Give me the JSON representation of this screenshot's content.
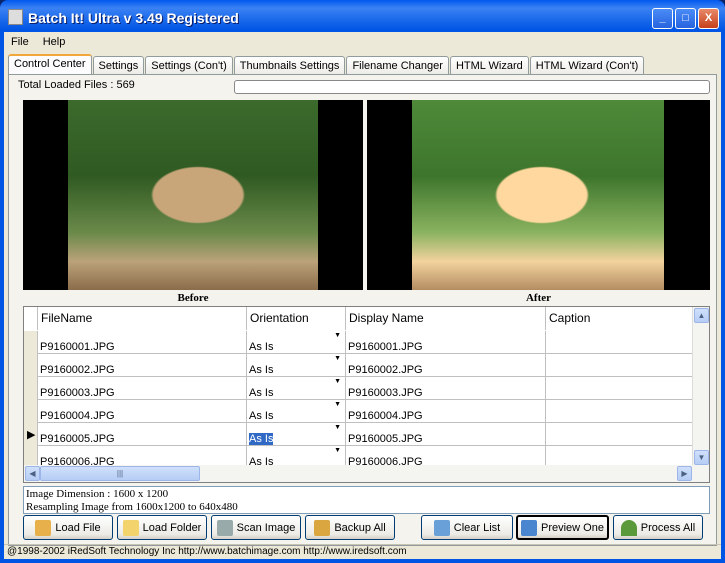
{
  "window": {
    "title": "Batch It! Ultra v 3.49  Registered",
    "min": "_",
    "max": "□",
    "close": "X"
  },
  "menu": [
    "File",
    "Help"
  ],
  "tabs": [
    "Control Center",
    "Settings",
    "Settings (Con't)",
    "Thumbnails Settings",
    "Filename Changer",
    "HTML Wizard",
    "HTML Wizard (Con't)"
  ],
  "total_loaded": "Total Loaded Files : 569",
  "progress": 0,
  "preview": {
    "before": "Before",
    "after": "After"
  },
  "grid": {
    "columns": [
      "FileName",
      "Orientation",
      "Display Name",
      "Caption"
    ],
    "rows": [
      {
        "file": "P9160001.JPG",
        "orientation": "As Is",
        "display": "P9160001.JPG",
        "caption": ""
      },
      {
        "file": "P9160002.JPG",
        "orientation": "As Is",
        "display": "P9160002.JPG",
        "caption": ""
      },
      {
        "file": "P9160003.JPG",
        "orientation": "As Is",
        "display": "P9160003.JPG",
        "caption": ""
      },
      {
        "file": "P9160004.JPG",
        "orientation": "As Is",
        "display": "P9160004.JPG",
        "caption": ""
      },
      {
        "file": "P9160005.JPG",
        "orientation": "As Is",
        "display": "P9160005.JPG",
        "caption": ""
      },
      {
        "file": "P9160006.JPG",
        "orientation": "As Is",
        "display": "P9160006.JPG",
        "caption": ""
      }
    ],
    "selected_row": 4
  },
  "log": [
    "Image Dimension : 1600 x 1200",
    "Resampling Image from 1600x1200 to 640x480"
  ],
  "buttons": {
    "load_file": "Load File",
    "load_folder": "Load Folder",
    "scan_image": "Scan Image",
    "backup_all": "Backup All",
    "clear_list": "Clear List",
    "preview_one": "Preview One",
    "process_all": "Process All"
  },
  "status": "@1998-2002 iRedSoft Technology Inc http://www.batchimage.com http://www.iredsoft.com"
}
